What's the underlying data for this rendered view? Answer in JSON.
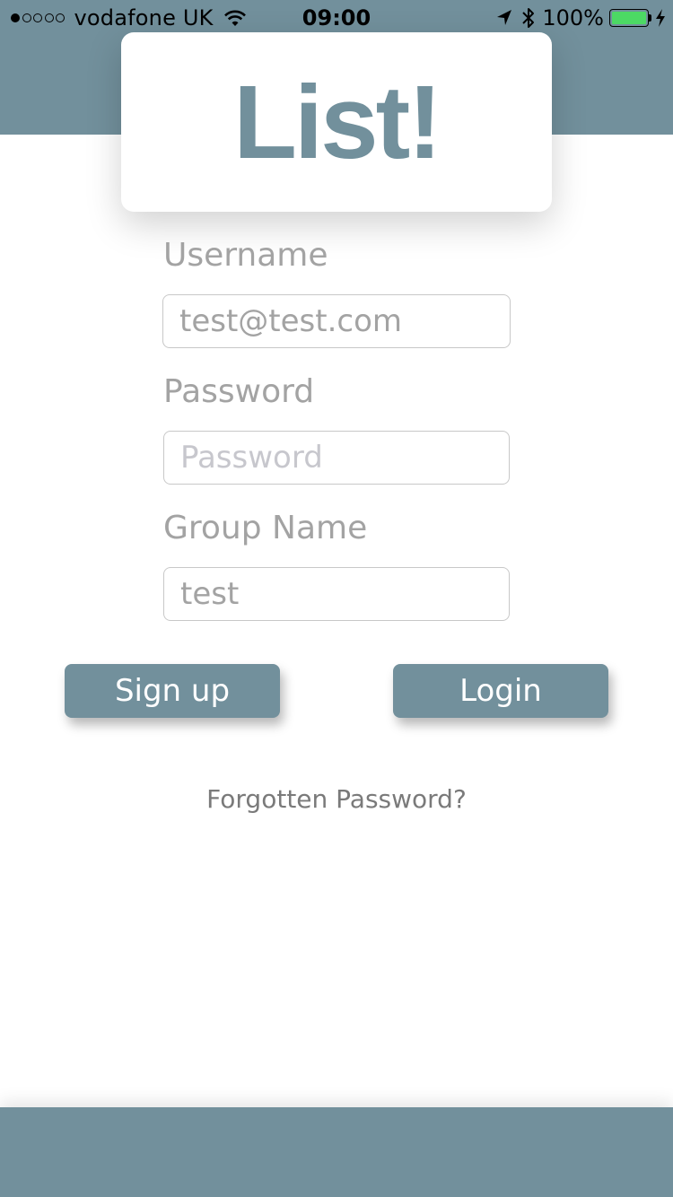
{
  "status_bar": {
    "carrier": "vodafone UK",
    "time": "09:00",
    "battery_percent": "100%",
    "signal_bars_filled": 1,
    "signal_bars_total": 5,
    "icons": [
      "wifi-icon",
      "location-arrow-icon",
      "bluetooth-icon",
      "battery-icon",
      "charging-bolt-icon"
    ]
  },
  "logo": {
    "text": "List!"
  },
  "form": {
    "username": {
      "label": "Username",
      "value": "test@test.com"
    },
    "password": {
      "label": "Password",
      "value": "",
      "placeholder": "Password"
    },
    "group_name": {
      "label": "Group Name",
      "value": "test"
    }
  },
  "buttons": {
    "sign_up": "Sign up",
    "login": "Login"
  },
  "forgot_password": "Forgotten Password?",
  "colors": {
    "accent": "#72909c",
    "label_text": "#a3a3a3",
    "link_text": "#7a7a7a",
    "battery_green": "#4cd964"
  }
}
